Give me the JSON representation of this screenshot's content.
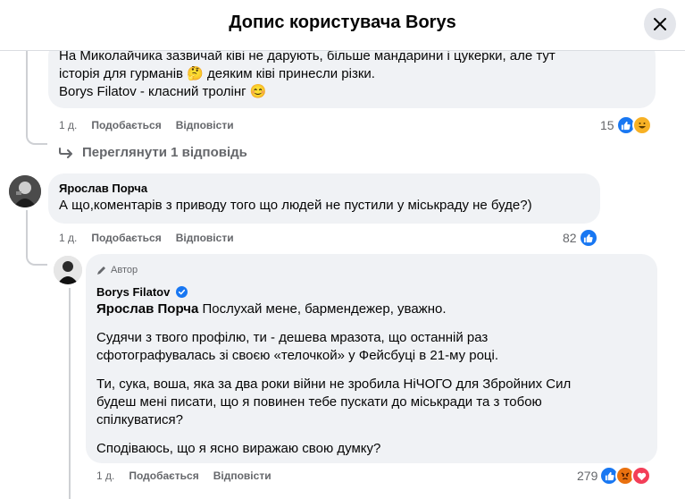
{
  "header": {
    "title": "Допис користувача Borys",
    "close_icon": "close-icon"
  },
  "comments": [
    {
      "lines": [
        "На Миколайчика зазвичай ківі не дарують, більше мандарини і цукерки, але тут",
        "історія для гурманів 🤔 деяким ківі принесли різки.",
        "Borys Filatov - класний тролінг 😊"
      ],
      "meta": {
        "time": "1 д.",
        "like": "Подобається",
        "reply": "Відповісти"
      },
      "reactions": {
        "count": "15",
        "types": [
          "like",
          "haha"
        ]
      },
      "view_replies": "Переглянути 1 відповідь"
    },
    {
      "author": "Ярослав Порча",
      "text": "А що,коментарів з приводу того що людей не пустили у міськраду не буде?)",
      "meta": {
        "time": "1 д.",
        "like": "Подобається",
        "reply": "Відповісти"
      },
      "reactions": {
        "count": "82",
        "types": [
          "like"
        ]
      }
    }
  ],
  "reply": {
    "badge": "Автор",
    "author": "Borys Filatov",
    "mention": "Ярослав Порча",
    "first_line": " Послухай мене, бармендежер, уважно.",
    "paragraphs": [
      [
        "Судячи з твого профілю, ти - дешева мразота, що останній раз",
        "сфотографувалась зі своєю «телочкой» у Фейсбуці в 21-му році."
      ],
      [
        "Ти, сука, воша, яка за два роки війни не зробила НіЧОГО для Збройних Сил",
        "будеш мені писати, що я повинен тебе пускати до міськради та з тобою",
        "спілкуватися?"
      ],
      [
        "Сподіваюсь, що я ясно виражаю свою думку?"
      ]
    ],
    "meta": {
      "time": "1 д.",
      "like": "Подобається",
      "reply": "Відповісти"
    },
    "reactions": {
      "count": "279",
      "types": [
        "like",
        "angry",
        "love"
      ]
    }
  },
  "colors": {
    "accent": "#1877f2",
    "bubble": "#f0f2f5",
    "secondary_text": "#65676b"
  }
}
